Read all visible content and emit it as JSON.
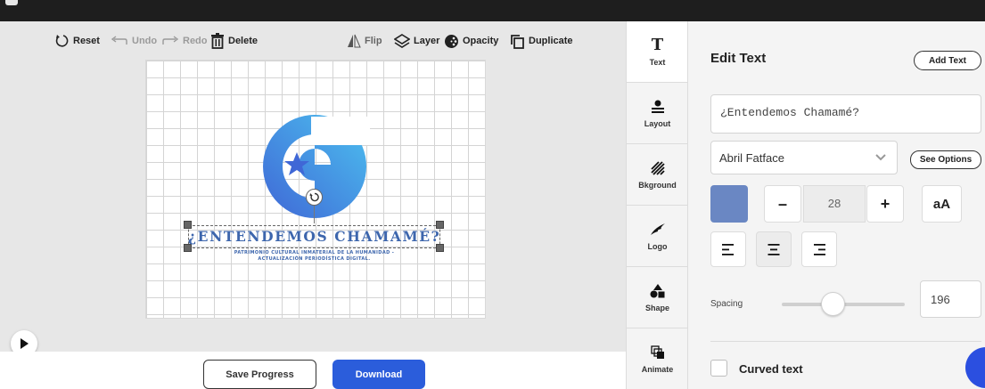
{
  "toolbar": {
    "reset_label": "Reset",
    "undo_label": "Undo",
    "redo_label": "Redo",
    "delete_label": "Delete",
    "flip_label": "Flip",
    "layer_label": "Layer",
    "opacity_label": "Opacity",
    "duplicate_label": "Duplicate"
  },
  "canvas": {
    "headline": "¿ENTENDEMOS CHAMAMÉ?",
    "subline_1": "PATRIMONIO CULTURAL INMATERIAL DE LA HUMANIDAD -",
    "subline_2": "ACTUALIZACIÓN PERIODÍSTICA DIGITAL.",
    "logo_gradient": [
      "#3f67d6",
      "#4cc0ef"
    ]
  },
  "bottom": {
    "save_label": "Save Progress",
    "download_label": "Download"
  },
  "sidetabs": [
    {
      "label": "Text",
      "icon": "text-icon",
      "active": true
    },
    {
      "label": "Layout",
      "icon": "layout-icon",
      "active": false
    },
    {
      "label": "Bkground",
      "icon": "background-icon",
      "active": false
    },
    {
      "label": "Logo",
      "icon": "logo-icon",
      "active": false
    },
    {
      "label": "Shape",
      "icon": "shape-icon",
      "active": false
    },
    {
      "label": "Animate",
      "icon": "animate-icon",
      "active": false
    }
  ],
  "panel": {
    "title": "Edit Text",
    "add_text_label": "Add Text",
    "text_value": "¿Entendemos Chamamé?",
    "font_value": "Abril Fatface",
    "see_options_label": "See Options",
    "text_color": "#6a87c3",
    "font_size": "28",
    "minus_label": "–",
    "plus_label": "+",
    "case_label": "aA",
    "alignment": "center",
    "spacing_label": "Spacing",
    "spacing_value": "196",
    "spacing_fraction": 0.4,
    "curved_label": "Curved text"
  },
  "colors": {
    "accent": "#2b5ddb",
    "topbar": "#1e1e1e"
  }
}
